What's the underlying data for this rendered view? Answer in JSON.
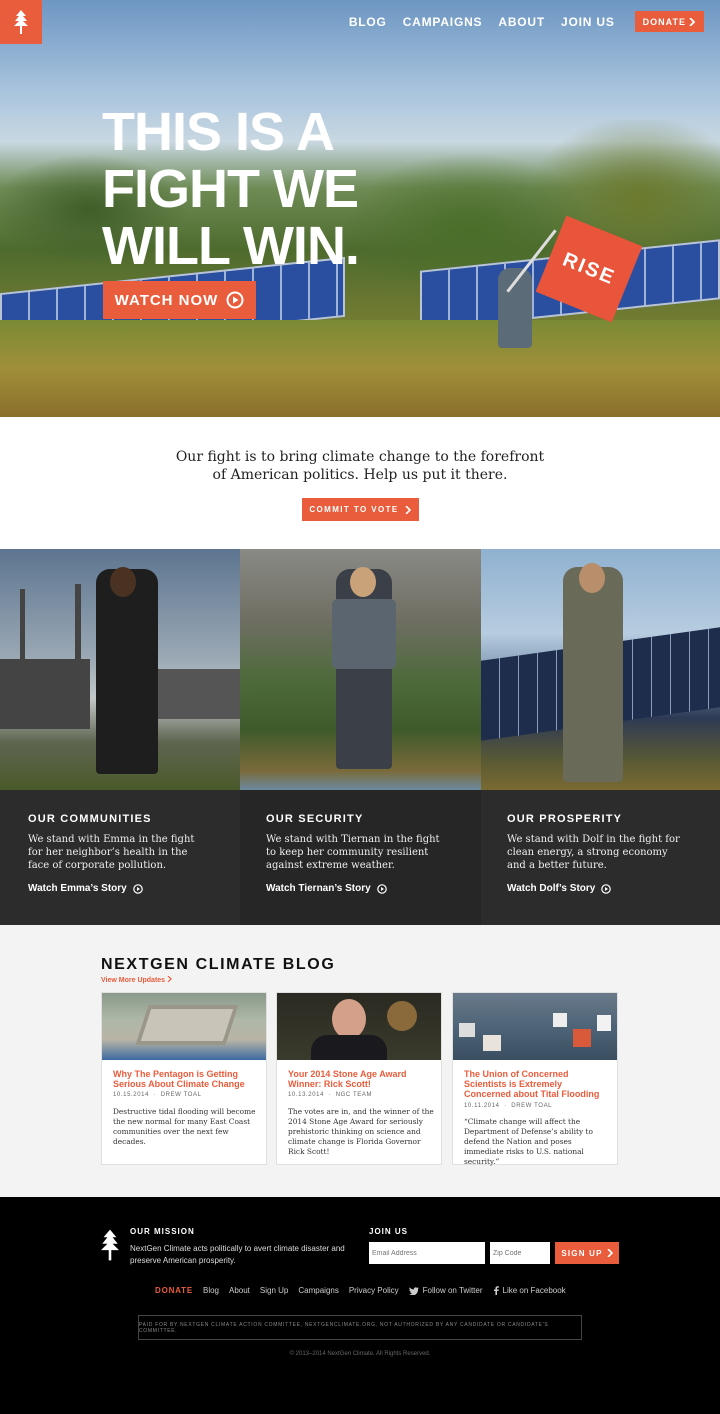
{
  "nav": {
    "items": [
      "BLOG",
      "CAMPAIGNS",
      "ABOUT",
      "JOIN US"
    ],
    "donate_label": "DONATE"
  },
  "hero": {
    "headline": "THIS IS A\nFIGHT WE\nWILL WIN.",
    "watch_label": "WATCH NOW",
    "flag_text": "RISE"
  },
  "mission": {
    "text": "Our fight is to bring climate change to the forefront\nof American politics. Help us put it there.",
    "commit_label": "COMMIT TO VOTE"
  },
  "stories": [
    {
      "title": "OUR COMMUNITIES",
      "text": "We stand with Emma in the fight for her neighbor’s health in the face of corporate pollution.",
      "link": "Watch Emma’s Story"
    },
    {
      "title": "OUR SECURITY",
      "text": "We stand with Tiernan in the fight to keep her community resilient against extreme weather.",
      "link": "Watch Tiernan’s Story"
    },
    {
      "title": "OUR PROSPERITY",
      "text": "We stand with Dolf in the fight for clean energy,  a strong economy and a better future.",
      "link": "Watch Dolf’s Story"
    }
  ],
  "blog": {
    "title": "NEXTGEN CLIMATE BLOG",
    "more": "View More Updates",
    "posts": [
      {
        "title": "Why The Pentagon is Getting Serious About Climate Change",
        "date": "10.15.2014",
        "author": "DREW TOAL",
        "body": "Destructive tidal flooding will become the new normal for many East Coast communities over the next few decades."
      },
      {
        "title": "Your 2014 Stone Age Award Winner: Rick Scott!",
        "date": "10.13.2014",
        "author": "NGC TEAM",
        "body": "The votes are in, and the winner of the 2014 Stone Age Award for seriously prehistoric thinking on science and climate change is Florida Governor Rick Scott!"
      },
      {
        "title": "The Union of Concerned Scientists is Extremely Concerned about Tital Flooding",
        "date": "10.11.2014",
        "author": "DREW TOAL",
        "body": "“Climate change will affect the Department of Defense’s ability to defend the Nation and poses immediate risks to U.S. national security.”"
      }
    ]
  },
  "footer": {
    "mission_title": "OUR MISSION",
    "mission_text": "NextGen Climate acts politically to avert climate disaster and preserve American prosperity.",
    "join_title": "JOIN US",
    "email_placeholder": "Email Address",
    "zip_placeholder": "Zip Code",
    "signup_label": "SIGN UP",
    "links": [
      "DONATE",
      "Blog",
      "About",
      "Sign Up",
      "Campaigns",
      "Privacy Policy"
    ],
    "twitter": "Follow on Twitter",
    "facebook": "Like on Facebook",
    "disclaimer": "PAID FOR BY NEXTGEN CLIMATE ACTION COMMITTEE, NEXTGENCLIMATE.ORG. NOT AUTHORIZED BY ANY CANDIDATE OR CANDIDATE'S COMMITTEE.",
    "copyright": "© 2013–2014 NextGen Climate. All Rights Reserved."
  },
  "colors": {
    "accent": "#e95c3c",
    "dark": "#2c2c2c",
    "footer": "#000000",
    "blog_bg": "#f3f3f3"
  },
  "icons": {
    "logo": "pine-tree-icon",
    "play": "play-circle-icon",
    "chevron": "chevron-right-icon",
    "twitter": "twitter-icon",
    "facebook": "facebook-icon"
  }
}
